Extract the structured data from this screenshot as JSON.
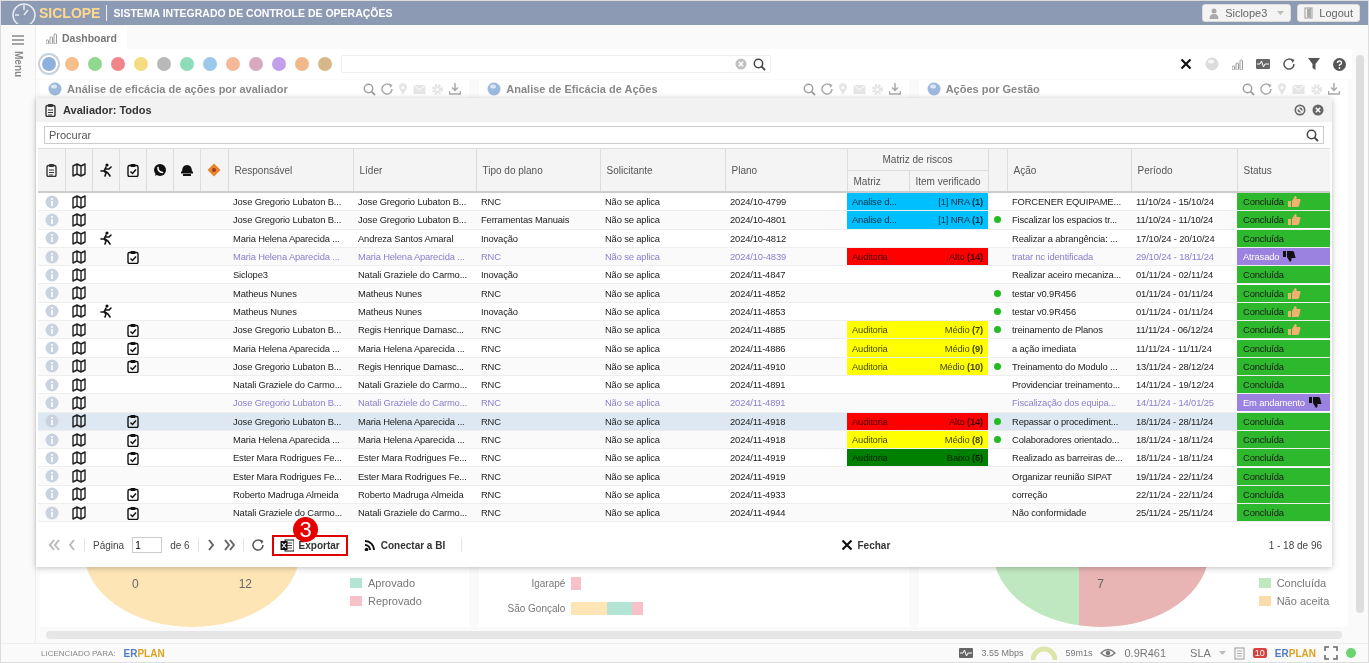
{
  "header": {
    "logo": "SICLOPE",
    "system_title": "SISTEMA INTEGRADO DE CONTROLE DE OPERAÇÕES",
    "user": "Siclope3",
    "logout": "Logout"
  },
  "sidebar": {
    "label": "Menu"
  },
  "tabs": [
    {
      "label": "Dashboard",
      "selected": true
    }
  ],
  "filters": [
    {
      "color": "#8fb0dc",
      "selected": true
    },
    {
      "color": "#f5c08a",
      "selected": false
    },
    {
      "color": "#8fd88f",
      "selected": false
    },
    {
      "color": "#f0868a",
      "selected": false
    },
    {
      "color": "#f5dc80",
      "selected": false
    },
    {
      "color": "#b8b8b8",
      "selected": false
    },
    {
      "color": "#8fdcb8",
      "selected": false
    },
    {
      "color": "#9cc8ec",
      "selected": false
    },
    {
      "color": "#f5b89a",
      "selected": false
    },
    {
      "color": "#d8a8c0",
      "selected": false
    },
    {
      "color": "#c0a0e8",
      "selected": false
    },
    {
      "color": "#f2b888",
      "selected": false
    },
    {
      "color": "#d8b888",
      "selected": false
    }
  ],
  "panels": [
    {
      "title": "Análise de eficácia de ações por avaliador",
      "kind": "pie",
      "pie_labels": [
        "0",
        "12"
      ],
      "legend": [
        {
          "label": "Aprovado",
          "color": "#b4e4d4"
        },
        {
          "label": "Reprovado",
          "color": "#f8c0c8"
        }
      ]
    },
    {
      "title": "Analise de Eficácia de Ações",
      "kind": "bar",
      "bar_labels": [
        "Igarapé",
        "São Gonçalo"
      ]
    },
    {
      "title": "Ações por Gestão",
      "kind": "pie",
      "pie_labels": [
        "7"
      ],
      "legend": [
        {
          "label": "Concluída",
          "color": "#c0e8c0"
        },
        {
          "label": "Não aceita",
          "color": "#fadcaa"
        }
      ]
    }
  ],
  "modal": {
    "title": "Avaliador: Todos",
    "search": {
      "placeholder": "Procurar"
    },
    "table": {
      "columns": [
        "Responsável",
        "Líder",
        "Tipo do plano",
        "Solicitante",
        "Plano"
      ],
      "risk_group": {
        "label": "Matriz de riscos",
        "columns": [
          "Matriz",
          "Item verificado"
        ]
      },
      "columns_after": [
        "Ação",
        "Período",
        "Status"
      ],
      "rows": [
        {
          "responsavel": "Jose Gregorio Lubaton B...",
          "lider": "Jose Gregorio Lubaton B...",
          "tipo": "RNC",
          "solicitante": "Não se aplica",
          "plano": "2024/10-4799",
          "risk": {
            "matriz": "Analise d...",
            "item": "[1] NRA **(1)**",
            "color": "#00bfff"
          },
          "verified": false,
          "acao": "FORCENER EQUIPAME...",
          "periodo": "11/10/24 - 15/10/24",
          "status": {
            "label": "Concluída",
            "color": "#2eb82e",
            "thumb_up": true,
            "thumb_down": false
          },
          "runner": false,
          "checklist": false,
          "dimmed": false,
          "selected": false
        },
        {
          "responsavel": "Jose Gregorio Lubaton B...",
          "lider": "Jose Gregorio Lubaton B...",
          "tipo": "Ferramentas Manuais",
          "solicitante": "Não se aplica",
          "plano": "2024/10-4801",
          "risk": {
            "matriz": "Analise d...",
            "item": "[1] NRA **(1)**",
            "color": "#00bfff"
          },
          "verified": true,
          "acao": "Fiscalizar los espacios tr...",
          "periodo": "11/10/24 - 11/10/24",
          "status": {
            "label": "Concluída",
            "color": "#2eb82e",
            "thumb_up": true,
            "thumb_down": false
          },
          "runner": false,
          "checklist": false,
          "dimmed": false,
          "selected": false
        },
        {
          "responsavel": "Maria Helena Aparecida ...",
          "lider": "Andreza Santos Amaral",
          "tipo": "Inovação",
          "solicitante": "Não se aplica",
          "plano": "2024/10-4812",
          "verified": false,
          "acao": "Realizar a abrangência: ...",
          "periodo": "17/10/24 - 20/10/24",
          "status": {
            "label": "Concluída",
            "color": "#2eb82e",
            "thumb_up": false,
            "thumb_down": false
          },
          "runner": true,
          "checklist": false,
          "dimmed": false,
          "selected": false
        },
        {
          "responsavel": "Maria Helena Aparecida ...",
          "lider": "Maria Helena Aparecida ...",
          "tipo": "RNC",
          "solicitante": "Não se aplica",
          "plano": "2024/10-4839",
          "risk": {
            "matriz": "Auditoria",
            "item": "Alto **(14)**",
            "color": "#ff0000"
          },
          "verified": false,
          "acao": "tratar nc identificada",
          "periodo": "29/10/24 - 18/11/24",
          "status": {
            "label": "Atrasado",
            "color": "#9b82e0",
            "thumb_up": false,
            "thumb_down": true
          },
          "runner": false,
          "checklist": true,
          "dimmed": true,
          "selected": false
        },
        {
          "responsavel": "Siclope3",
          "lider": "Natali Graziele do Carmo...",
          "tipo": "Inovação",
          "solicitante": "Não se aplica",
          "plano": "2024/11-4847",
          "verified": false,
          "acao": "Realizar aceiro mecaniza...",
          "periodo": "01/11/24 - 02/11/24",
          "status": {
            "label": "Concluída",
            "color": "#2eb82e",
            "thumb_up": false,
            "thumb_down": false
          },
          "runner": false,
          "checklist": false,
          "dimmed": false,
          "selected": false
        },
        {
          "responsavel": "Matheus Nunes",
          "lider": "Matheus Nunes",
          "tipo": "RNC",
          "solicitante": "Não se aplica",
          "plano": "2024/11-4852",
          "verified": true,
          "acao": "testar v0.9R456",
          "periodo": "01/11/24 - 01/11/24",
          "status": {
            "label": "Concluída",
            "color": "#2eb82e",
            "thumb_up": true,
            "thumb_down": false
          },
          "runner": false,
          "checklist": false,
          "dimmed": false,
          "selected": false
        },
        {
          "responsavel": "Matheus Nunes",
          "lider": "Matheus Nunes",
          "tipo": "Inovação",
          "solicitante": "Não se aplica",
          "plano": "2024/11-4853",
          "verified": true,
          "acao": "testar v0.9R456",
          "periodo": "01/11/24 - 01/11/24",
          "status": {
            "label": "Concluída",
            "color": "#2eb82e",
            "thumb_up": true,
            "thumb_down": false
          },
          "runner": true,
          "checklist": false,
          "dimmed": false,
          "selected": false
        },
        {
          "responsavel": "Jose Gregorio Lubaton B...",
          "lider": "Regis Henrique Damasc...",
          "tipo": "RNC",
          "solicitante": "Não se aplica",
          "plano": "2024/11-4885",
          "risk": {
            "matriz": "Auditoria",
            "item": "Médio **(7)**",
            "color": "#ffff00"
          },
          "verified": true,
          "acao": "treinamento de Planos",
          "periodo": "11/11/24 - 06/12/24",
          "status": {
            "label": "Concluída",
            "color": "#2eb82e",
            "thumb_up": true,
            "thumb_down": false
          },
          "runner": false,
          "checklist": true,
          "dimmed": false,
          "selected": false
        },
        {
          "responsavel": "Maria Helena Aparecida ...",
          "lider": "Maria Helena Aparecida ...",
          "tipo": "RNC",
          "solicitante": "Não se aplica",
          "plano": "2024/11-4886",
          "risk": {
            "matriz": "Auditoria",
            "item": "Médio **(9)**",
            "color": "#ffff00"
          },
          "verified": false,
          "acao": "a ação imediata",
          "periodo": "11/11/24 - 11/11/24",
          "status": {
            "label": "Concluída",
            "color": "#2eb82e",
            "thumb_up": false,
            "thumb_down": false
          },
          "runner": false,
          "checklist": true,
          "dimmed": false,
          "selected": false
        },
        {
          "responsavel": "Jose Gregorio Lubaton B...",
          "lider": "Regis Henrique Damasc...",
          "tipo": "RNC",
          "solicitante": "Não se aplica",
          "plano": "2024/11-4910",
          "risk": {
            "matriz": "Auditoria",
            "item": "Médio **(10)**",
            "color": "#ffff00"
          },
          "verified": true,
          "acao": "Treinamento do Modulo ...",
          "periodo": "13/11/24 - 28/12/24",
          "status": {
            "label": "Concluída",
            "color": "#2eb82e",
            "thumb_up": false,
            "thumb_down": false
          },
          "runner": false,
          "checklist": true,
          "dimmed": false,
          "selected": false
        },
        {
          "responsavel": "Natali Graziele do Carmo...",
          "lider": "Natali Graziele do Carmo...",
          "tipo": "RNC",
          "solicitante": "Não se aplica",
          "plano": "2024/11-4891",
          "verified": false,
          "acao": "Providenciar treinamento...",
          "periodo": "14/11/24 - 19/12/24",
          "status": {
            "label": "Concluída",
            "color": "#2eb82e",
            "thumb_up": false,
            "thumb_down": false
          },
          "runner": false,
          "checklist": false,
          "dimmed": false,
          "selected": false
        },
        {
          "responsavel": "Jose Gregorio Lubaton B...",
          "lider": "Natali Graziele do Carmo...",
          "tipo": "RNC",
          "solicitante": "Não se aplica",
          "plano": "2024/11-4891",
          "verified": false,
          "acao": "Fiscalização dos equipa...",
          "periodo": "14/11/24 - 14/01/25",
          "status": {
            "label": "Em andamento",
            "color": "#9b82e0",
            "thumb_up": false,
            "thumb_down": true
          },
          "runner": false,
          "checklist": false,
          "dimmed": true,
          "selected": false
        },
        {
          "responsavel": "Jose Gregorio Lubaton B...",
          "lider": "Maria Helena Aparecida ...",
          "tipo": "RNC",
          "solicitante": "Não se aplica",
          "plano": "2024/11-4918",
          "risk": {
            "matriz": "Auditoria",
            "item": "Alto **(14)**",
            "color": "#ff0000"
          },
          "verified": true,
          "acao": "Repassar o procediment...",
          "periodo": "18/11/24 - 28/11/24",
          "status": {
            "label": "Concluída",
            "color": "#2eb82e",
            "thumb_up": false,
            "thumb_down": false
          },
          "runner": false,
          "checklist": true,
          "dimmed": false,
          "selected": true
        },
        {
          "responsavel": "Maria Helena Aparecida ...",
          "lider": "Maria Helena Aparecida ...",
          "tipo": "RNC",
          "solicitante": "Não se aplica",
          "plano": "2024/11-4918",
          "risk": {
            "matriz": "Auditoria",
            "item": "Médio **(8)**",
            "color": "#ffff00"
          },
          "verified": true,
          "acao": "Colaboradores orientado...",
          "periodo": "18/11/24 - 18/11/24",
          "status": {
            "label": "Concluída",
            "color": "#2eb82e",
            "thumb_up": false,
            "thumb_down": false
          },
          "runner": false,
          "checklist": true,
          "dimmed": false,
          "selected": false
        },
        {
          "responsavel": "Ester Mara Rodrigues Fe...",
          "lider": "Ester Mara Rodrigues Fe...",
          "tipo": "RNC",
          "solicitante": "Não se aplica",
          "plano": "2024/11-4919",
          "risk": {
            "matriz": "Auditoria",
            "item": "Baixo **(5)**",
            "color": "#008000"
          },
          "verified": false,
          "acao": "Realizado as barreiras de...",
          "periodo": "18/11/24 - 18/11/24",
          "status": {
            "label": "Concluída",
            "color": "#2eb82e",
            "thumb_up": false,
            "thumb_down": false
          },
          "runner": false,
          "checklist": true,
          "dimmed": false,
          "selected": false
        },
        {
          "responsavel": "Ester Mara Rodrigues Fe...",
          "lider": "Ester Mara Rodrigues Fe...",
          "tipo": "RNC",
          "solicitante": "Não se aplica",
          "plano": "2024/11-4919",
          "verified": false,
          "acao": "Organizar reunião SIPAT",
          "periodo": "19/11/24 - 22/11/24",
          "status": {
            "label": "Concluída",
            "color": "#2eb82e",
            "thumb_up": false,
            "thumb_down": false
          },
          "runner": false,
          "checklist": false,
          "dimmed": false,
          "selected": false
        },
        {
          "responsavel": "Roberto Madruga Almeida",
          "lider": "Roberto Madruga Almeida",
          "tipo": "RNC",
          "solicitante": "Não se aplica",
          "plano": "2024/11-4933",
          "verified": false,
          "acao": "correção",
          "periodo": "22/11/24 - 22/11/24",
          "status": {
            "label": "Concluída",
            "color": "#2eb82e",
            "thumb_up": false,
            "thumb_down": false
          },
          "runner": false,
          "checklist": true,
          "dimmed": false,
          "selected": false
        },
        {
          "responsavel": "Natali Graziele do Carmo...",
          "lider": "Natali Graziele do Carmo...",
          "tipo": "RNC",
          "solicitante": "Não se aplica",
          "plano": "2024/11-4944",
          "verified": false,
          "acao": "Não conformidade",
          "periodo": "25/11/24 - 25/11/24",
          "status": {
            "label": "Concluída",
            "color": "#2eb82e",
            "thumb_up": false,
            "thumb_down": false
          },
          "runner": false,
          "checklist": true,
          "dimmed": false,
          "selected": false
        }
      ]
    },
    "footer": {
      "page_label": "Página",
      "page": "1",
      "page_total": "de 6",
      "export": "Exportar",
      "bi": "Conectar a BI",
      "close": "Fechar",
      "range": "1 - 18 de 96"
    }
  },
  "callout": {
    "number": "3"
  },
  "status_bar": {
    "licensed": "LICENCIADO PARA:",
    "brand_left": [
      "ER",
      "PLAN"
    ],
    "speed": "3.55 Mbps",
    "timer": "59m1s",
    "version": "0.9R461",
    "sla": "SLA",
    "notifications": "10",
    "brand_right": [
      "ER",
      "PLAN"
    ]
  }
}
